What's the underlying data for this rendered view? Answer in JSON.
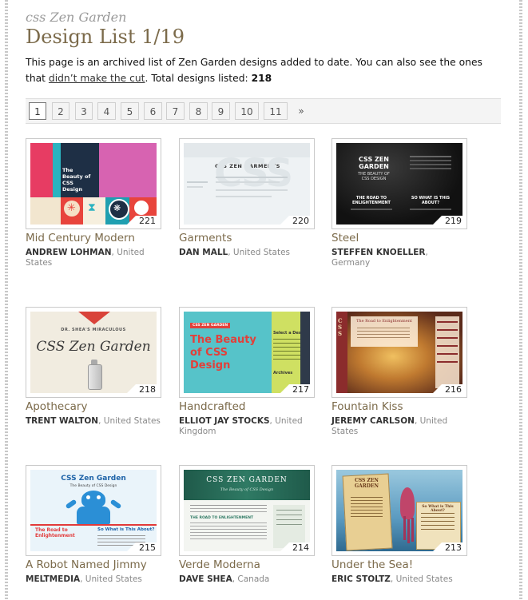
{
  "site": {
    "brand": "css Zen Garden"
  },
  "page": {
    "title": "Design List 1/19",
    "intro_text": "This page is an archived list of Zen Garden designs added to date. You can also see the ones that",
    "intro_link": "didn’t make the cut",
    "intro_after": ". Total designs listed: ",
    "total": "218"
  },
  "pagination": {
    "pages": [
      "1",
      "2",
      "3",
      "4",
      "5",
      "6",
      "7",
      "8",
      "9",
      "10",
      "11"
    ],
    "current": "1",
    "next": "»"
  },
  "designs": [
    {
      "name": "Mid Century Modern",
      "author": "ANDREW LOHMAN",
      "location": ", United States",
      "number": "221",
      "thumb": {
        "heading": "The Beauty of CSS Design"
      }
    },
    {
      "name": "Garments",
      "author": "DAN MALL",
      "location": ", United States",
      "number": "220",
      "thumb": {
        "heading": "CSS ZEN GARMENTS"
      }
    },
    {
      "name": "Steel",
      "author": "STEFFEN KNOELLER",
      "location": ", Germany",
      "number": "219",
      "thumb": {
        "heading": "CSS ZEN GARDEN",
        "sub": "THE BEAUTY OF CSS DESIGN",
        "left": "THE ROAD TO ENLIGHTENMENT",
        "right": "SO WHAT IS THIS ABOUT?"
      }
    },
    {
      "name": "Apothecary",
      "author": "TRENT WALTON",
      "location": ", United States",
      "number": "218",
      "thumb": {
        "kicker": "DR. SHEA'S MIRACULOUS",
        "heading": "CSS Zen Garden"
      }
    },
    {
      "name": "Handcrafted",
      "author": "ELLIOT JAY STOCKS",
      "location": ", United Kingdom",
      "number": "217",
      "thumb": {
        "tag": "CSS ZEN GARDEN",
        "heading": "The Beauty of CSS Design",
        "side": "Select a Design:",
        "archives": "Archives"
      }
    },
    {
      "name": "Fountain Kiss",
      "author": "JEREMY CARLSON",
      "location": ", United States",
      "number": "216",
      "thumb": {
        "heading": "The Road to Enlightenment"
      }
    },
    {
      "name": "A Robot Named Jimmy",
      "author": "MELTMEDIA",
      "location": ", United States",
      "number": "215",
      "thumb": {
        "heading": "CSS Zen Garden",
        "sub": "The Beauty of CSS Design",
        "left": "The Road to Enlightenment",
        "right": "So What is This About?"
      }
    },
    {
      "name": "Verde Moderna",
      "author": "DAVE SHEA",
      "location": ", Canada",
      "number": "214",
      "thumb": {
        "heading": "CSS ZEN GARDEN",
        "sub": "The Beauty of CSS Design",
        "road": "THE ROAD TO ENLIGHTENMENT"
      }
    },
    {
      "name": "Under the Sea!",
      "author": "ERIC STOLTZ",
      "location": ", United States",
      "number": "213",
      "thumb": {
        "heading": "CSS ZEN GARDEN",
        "sub": "So What is This About?"
      }
    }
  ],
  "colors": {
    "title": "#7b6a4a",
    "link": "#333333"
  }
}
